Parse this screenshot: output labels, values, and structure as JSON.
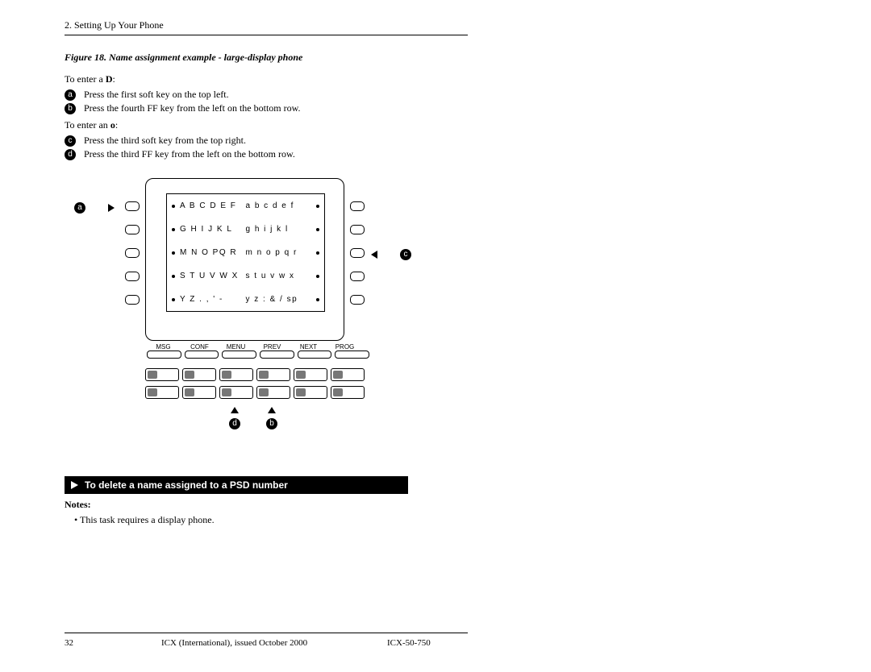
{
  "header": {
    "running": "2. Setting Up Your Phone"
  },
  "figure": {
    "caption": "Figure 18.  Name assignment example - large-display phone"
  },
  "intro": {
    "enter_d_prefix": "To enter a ",
    "enter_d_bold": "D",
    "enter_d_suffix": ":",
    "enter_o_prefix": "To enter an ",
    "enter_o_bold": "o",
    "enter_o_suffix": ":"
  },
  "steps": {
    "a": {
      "label": "a",
      "text": "Press the first soft key on the top left."
    },
    "b": {
      "label": "b",
      "text": "Press the fourth FF key from the left on the bottom row."
    },
    "c": {
      "label": "c",
      "text": "Press the third soft key from the top right."
    },
    "d": {
      "label": "d",
      "text": "Press the third FF key from the left on the bottom row."
    }
  },
  "lcd": {
    "rows": [
      {
        "left": "A B C D E F",
        "right": "a b c d e f"
      },
      {
        "left": "G H I J K L",
        "right": "g h i j k l"
      },
      {
        "left": "M N O PQ R",
        "right": "m n o p q r"
      },
      {
        "left": "S T U V W X",
        "right": "s t u v w x"
      },
      {
        "left": "Y Z . , ' -",
        "right": "y z : & / sp"
      }
    ]
  },
  "fn_labels": [
    "MSG",
    "CONF",
    "MENU",
    "PREV",
    "NEXT",
    "PROG"
  ],
  "callouts": {
    "a": "a",
    "b": "b",
    "c": "c",
    "d": "d"
  },
  "section": {
    "title": "To delete a name assigned to a PSD number"
  },
  "notes": {
    "label": "Notes:",
    "items": [
      "This task requires a display phone."
    ]
  },
  "footer": {
    "page": "32",
    "center": "ICX (International), issued October 2000",
    "code": "ICX-50-750"
  }
}
